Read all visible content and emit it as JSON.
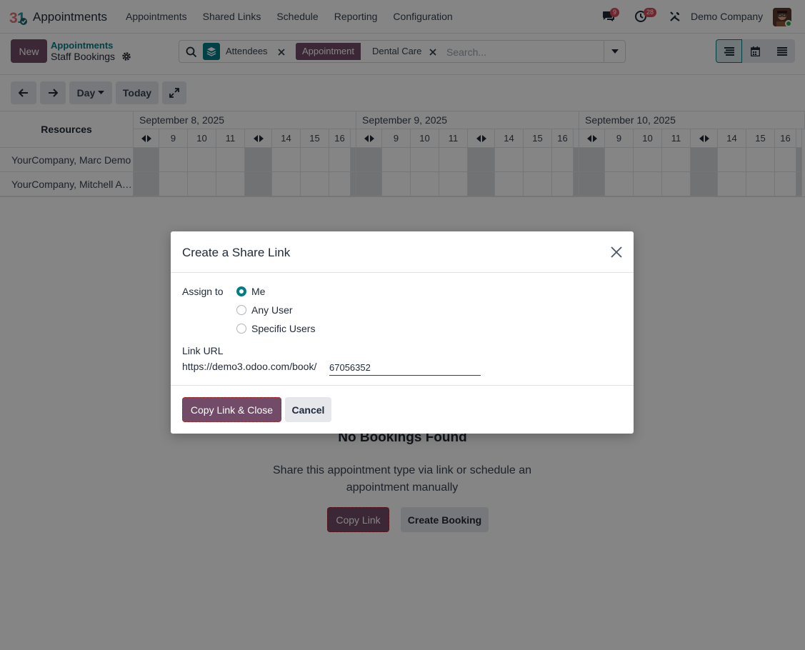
{
  "navbar": {
    "app_name": "Appointments",
    "menu": [
      "Appointments",
      "Shared Links",
      "Schedule",
      "Reporting",
      "Configuration"
    ],
    "messages_badge": "9",
    "activities_badge": "28",
    "company": "Demo Company"
  },
  "control_panel": {
    "new_label": "New",
    "breadcrumb_parent": "Appointments",
    "breadcrumb_current": "Staff Bookings",
    "search": {
      "facet1_value": "Attendees",
      "facet2_label": "Appointment",
      "facet2_value": "Dental Care",
      "placeholder": "Search..."
    }
  },
  "toolbar": {
    "scale_label": "Day",
    "today_label": "Today"
  },
  "gantt": {
    "resources_header": "Resources",
    "dates": [
      "September 8, 2025",
      "September 9, 2025",
      "September 10, 2025"
    ],
    "hours": [
      "9",
      "10",
      "11",
      "14",
      "15",
      "16"
    ],
    "rows": [
      "YourCompany, Marc Demo",
      "YourCompany, Mitchell Admin"
    ]
  },
  "empty_state": {
    "title": "No Bookings Found",
    "text": "Share this appointment type via link or schedule an appointment manually",
    "copy_link": "Copy Link",
    "create_booking": "Create Booking"
  },
  "modal": {
    "title": "Create a Share Link",
    "assign_label": "Assign to",
    "options": [
      "Me",
      "Any User",
      "Specific Users"
    ],
    "selected": "Me",
    "link_label": "Link URL",
    "link_prefix": "https://demo3.odoo.com/book/",
    "link_code": "67056352",
    "copy_close": "Copy Link & Close",
    "cancel": "Cancel"
  },
  "colors": {
    "brand": "#714b67",
    "accent": "#017e84",
    "badge": "#d44c59"
  }
}
